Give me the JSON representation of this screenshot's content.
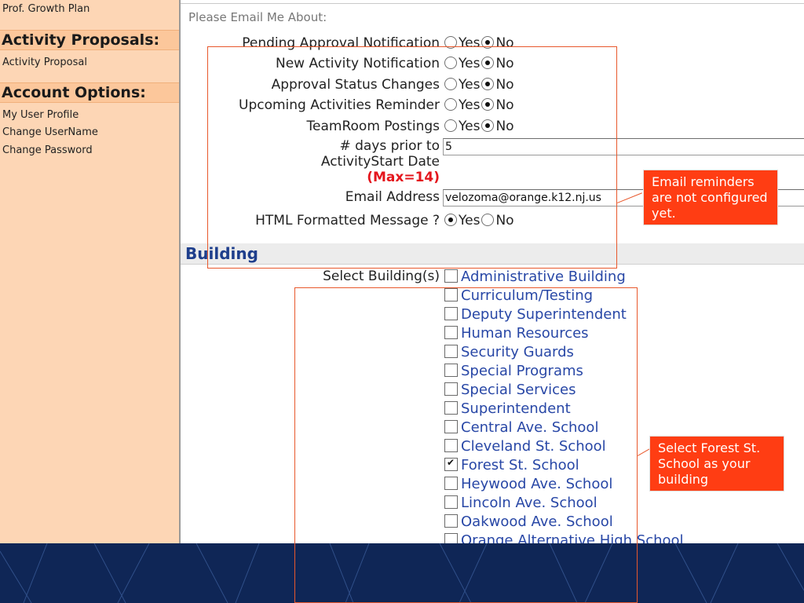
{
  "sidebar": {
    "growth_plan_link": "Prof. Growth Plan",
    "activity_heading": "Activity Proposals:",
    "activity_proposal_link": "Activity Proposal",
    "account_heading": "Account Options:",
    "account_links": [
      "My User Profile",
      "Change UserName",
      "Change Password"
    ]
  },
  "email_prefs": {
    "section_hint": "Please Email Me About:",
    "yes_label": "Yes",
    "no_label": "No",
    "rows": [
      {
        "label": "Pending Approval Notification",
        "selected": "No"
      },
      {
        "label": "New Activity Notification",
        "selected": "No"
      },
      {
        "label": "Approval Status Changes",
        "selected": "No"
      },
      {
        "label": "Upcoming Activities Reminder",
        "selected": "No"
      },
      {
        "label": "TeamRoom Postings",
        "selected": "No"
      }
    ],
    "days_prior_label_line1": "# days prior to",
    "days_prior_label_line2": "ActivityStart Date",
    "days_prior_max": "(Max=14)",
    "days_prior_value": "5",
    "email_label": "Email Address",
    "email_value": "velozoma@orange.k12.nj.us",
    "html_label": "HTML Formatted Message ?",
    "html_selected": "Yes"
  },
  "building": {
    "section_title": "Building",
    "select_label": "Select Building(s)",
    "options": [
      {
        "name": "Administrative Building",
        "checked": false
      },
      {
        "name": "Curriculum/Testing",
        "checked": false
      },
      {
        "name": "Deputy Superintendent",
        "checked": false
      },
      {
        "name": "Human Resources",
        "checked": false
      },
      {
        "name": "Security Guards",
        "checked": false
      },
      {
        "name": "Special Programs",
        "checked": false
      },
      {
        "name": "Special Services",
        "checked": false
      },
      {
        "name": "Superintendent",
        "checked": false
      },
      {
        "name": "Central Ave. School",
        "checked": false
      },
      {
        "name": "Cleveland St. School",
        "checked": false
      },
      {
        "name": "Forest St. School",
        "checked": true
      },
      {
        "name": "Heywood Ave. School",
        "checked": false
      },
      {
        "name": "Lincoln Ave. School",
        "checked": false
      },
      {
        "name": "Oakwood Ave. School",
        "checked": false
      },
      {
        "name": "Orange Alternative High School",
        "checked": false
      }
    ]
  },
  "annotations": {
    "email_callout": "Email reminders are not configured yet.",
    "building_callout": "Select Forest St. School as your building",
    "color": "#ff3d13"
  },
  "theme": {
    "sidebar_bg": "#fdd6b5",
    "building_text": "#2847a6",
    "bottom_strip": "#0f2656"
  }
}
